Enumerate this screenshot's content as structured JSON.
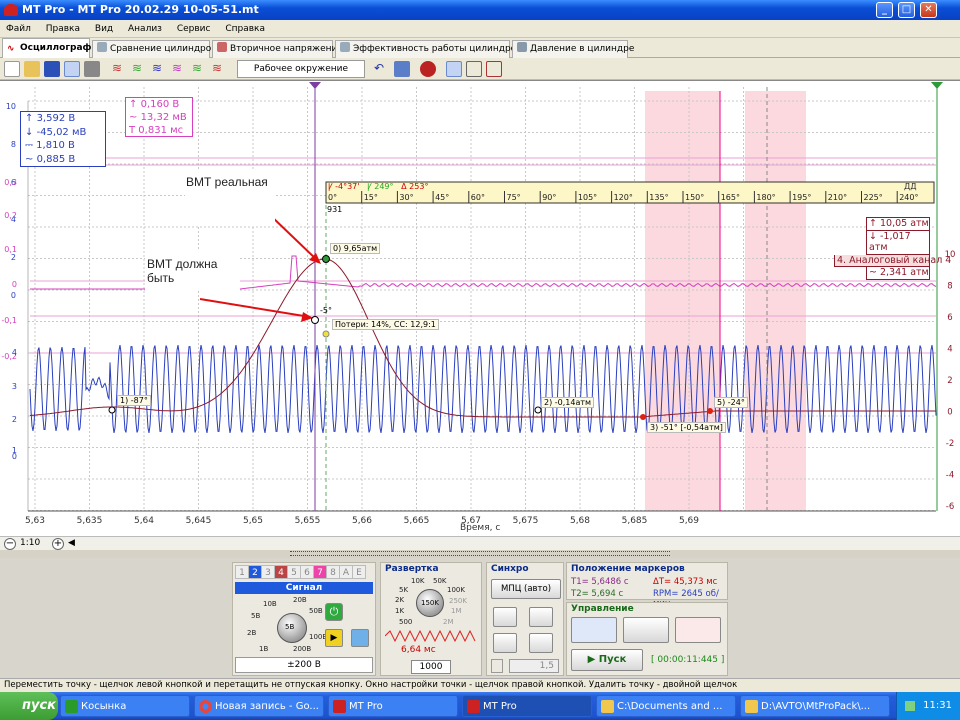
{
  "window": {
    "title": "MT Pro - MT Pro 20.02.29 10-05-51.mt"
  },
  "menu": [
    "Файл",
    "Правка",
    "Вид",
    "Анализ",
    "Сервис",
    "Справка"
  ],
  "tabs": [
    "Осциллограф",
    "Сравнение цилиндров",
    "Вторичное напряжение",
    "Эффективность работы цилиндров",
    "Давление в цилиндре"
  ],
  "toolbar": {
    "environment": "Рабочее окружение"
  },
  "plot": {
    "xlabel": "Время, с",
    "x_ticks": [
      "5,63",
      "5,635",
      "5,64",
      "5,645",
      "5,65",
      "5,655",
      "5,66",
      "5,665",
      "5,67",
      "5,675",
      "5,68",
      "5,685",
      "5,69"
    ],
    "left_ticks_ch1": [
      "10",
      "8",
      "6",
      "4",
      "2",
      "0"
    ],
    "left_ticks_ch2": [
      "0,3",
      "0,2",
      "0,1",
      "0",
      "-0,1",
      "-0,2"
    ],
    "left_ticks_ch3": [
      "4",
      "3",
      "2",
      "1",
      "0"
    ],
    "right_ticks": [
      "10",
      "8",
      "6",
      "4",
      "2",
      "0",
      "-2",
      "-4",
      "-6"
    ],
    "angle_scale": {
      "header": [
        "Ꝩ -4°37'",
        "Ꝩ 249°",
        "Δ 253°"
      ],
      "ticks": [
        "0°",
        "15°",
        "30°",
        "45°",
        "60°",
        "75°",
        "90°",
        "105°",
        "120°",
        "135°",
        "150°",
        "165°",
        "180°",
        "195°",
        "210°",
        "225°",
        "240°"
      ],
      "rpm": "931",
      "dd": "ДД"
    },
    "ch1_box": [
      "3,592 В",
      "-45,02 мВ",
      "1,810 В",
      "0,885 В"
    ],
    "ch2_box": [
      "0,160 В",
      "13,32 мВ",
      "0,831 мс"
    ],
    "pressure_box": {
      "max": "10,05 атм",
      "min": "-1,017 атм",
      "channel": "4. Аналоговый канал 4",
      "avg": "2,341 атм"
    },
    "annotations": {
      "real": "ВМТ реальная",
      "should": "ВМТ должна быть"
    },
    "points": [
      "0) 9,65атм",
      "-5°",
      "Потери: 14%, СС: 12,9:1",
      "1) -87°",
      "2) -0,14атм",
      "3) -51° [-0,54атм]",
      "5) -24°"
    ]
  },
  "zoom": "1:10",
  "signal": {
    "title": "Сигнал",
    "channels": [
      "1",
      "2",
      "3",
      "4",
      "5",
      "6",
      "7",
      "8",
      "A",
      "E"
    ],
    "range": "±200 В",
    "knob_center": "5В",
    "knob_labels": [
      "10В",
      "20В",
      "5В",
      "50В",
      "2В",
      "100В",
      "1В",
      "200В"
    ]
  },
  "sweep": {
    "title": "Развертка",
    "knob_center": "150K",
    "knob_labels": [
      "10K",
      "50K",
      "5K",
      "100K",
      "2K",
      "250K",
      "1K",
      "1M",
      "500",
      "2M"
    ],
    "time": "6,64 мс",
    "samples": "1000"
  },
  "sync": {
    "title": "Синхро",
    "mode": "МПЦ (авто)",
    "level": "1,5"
  },
  "markers": {
    "title": "Положение маркеров",
    "t1": "T1= 5,6486 с",
    "dt": "ΔT= 45,373 мс",
    "t2": "T2= 5,694 с",
    "rpm": "RPM= 2645 об/мин"
  },
  "control": {
    "title": "Управление",
    "start": "Пуск",
    "timer": "[ 00:00:11:445 ]"
  },
  "status": "Переместить точку - щелчок левой кнопкой и перетащить не отпуская кнопку. Окно настройки точки - щелчок правой кнопкой. Удалить точку - двойной щелчок",
  "taskbar": {
    "start": "пуск",
    "tasks": [
      "Косынка",
      "Новая запись - Go...",
      "MT Pro",
      "MT Pro",
      "C:\\Documents and ...",
      "D:\\AVTO\\MtProPack\\..."
    ],
    "clock": "11:31"
  },
  "colors": {
    "accent_blue": "#2a3fbf",
    "pressure": "#8b1a2b",
    "pink": "#d63fbf",
    "marker": "#7a3fa0",
    "green": "#2e9a3a"
  }
}
